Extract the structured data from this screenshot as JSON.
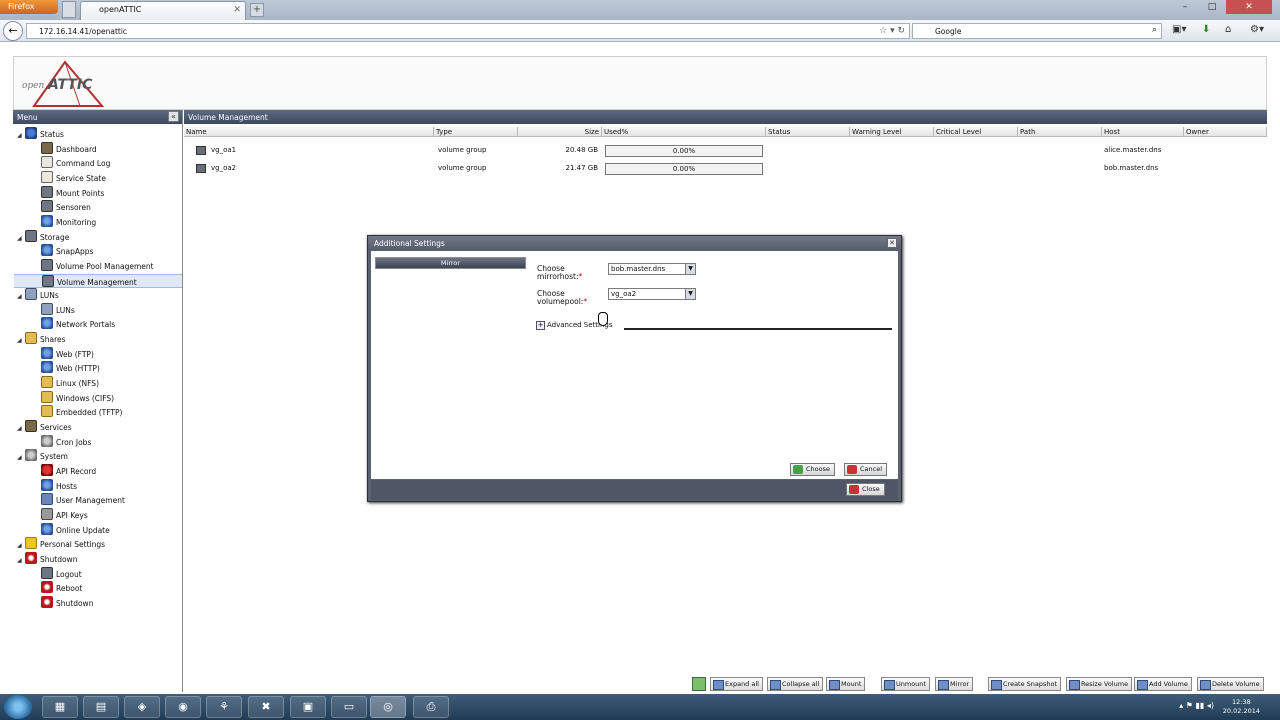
{
  "browser": {
    "app_button": "Firefox",
    "tab_title": "openATTIC",
    "url": "172.16.14.41/openattic",
    "search_engine": "Google",
    "window_controls": [
      "–",
      "□",
      "✕"
    ]
  },
  "app": {
    "logo_text_open": "open",
    "logo_text_attic": "ATTIC"
  },
  "menu": {
    "title": "Menu",
    "items": [
      {
        "label": "Status",
        "icon": "status-icon",
        "level": 0
      },
      {
        "label": "Dashboard",
        "icon": "dashboard-icon",
        "level": 1
      },
      {
        "label": "Command Log",
        "icon": "log-icon",
        "level": 1
      },
      {
        "label": "Service State",
        "icon": "service-icon",
        "level": 1
      },
      {
        "label": "Mount Points",
        "icon": "mount-icon",
        "level": 1
      },
      {
        "label": "Sensoren",
        "icon": "sensor-icon",
        "level": 1
      },
      {
        "label": "Monitoring",
        "icon": "monitoring-icon",
        "level": 1
      },
      {
        "label": "Storage",
        "icon": "storage-icon",
        "level": 0
      },
      {
        "label": "SnapApps",
        "icon": "snapapps-icon",
        "level": 1
      },
      {
        "label": "Volume Pool Management",
        "icon": "pool-icon",
        "level": 1
      },
      {
        "label": "Volume Management",
        "icon": "volume-icon",
        "level": 1,
        "selected": true
      },
      {
        "label": "LUNs",
        "icon": "luns-icon",
        "level": 0
      },
      {
        "label": "LUNs",
        "icon": "lun-icon",
        "level": 1
      },
      {
        "label": "Network Portals",
        "icon": "network-icon",
        "level": 1
      },
      {
        "label": "Shares",
        "icon": "shares-icon",
        "level": 0
      },
      {
        "label": "Web (FTP)",
        "icon": "globe-icon",
        "level": 1
      },
      {
        "label": "Web (HTTP)",
        "icon": "globe-icon",
        "level": 1
      },
      {
        "label": "Linux (NFS)",
        "icon": "folder-icon",
        "level": 1
      },
      {
        "label": "Windows (CIFS)",
        "icon": "folder-icon",
        "level": 1
      },
      {
        "label": "Embedded (TFTP)",
        "icon": "folder-icon",
        "level": 1
      },
      {
        "label": "Services",
        "icon": "services-icon",
        "level": 0
      },
      {
        "label": "Cron Jobs",
        "icon": "cron-icon",
        "level": 1
      },
      {
        "label": "System",
        "icon": "system-icon",
        "level": 0
      },
      {
        "label": "API Record",
        "icon": "record-icon",
        "level": 1
      },
      {
        "label": "Hosts",
        "icon": "hosts-icon",
        "level": 1
      },
      {
        "label": "User Management",
        "icon": "user-icon",
        "level": 1
      },
      {
        "label": "API Keys",
        "icon": "key-icon",
        "level": 1
      },
      {
        "label": "Online Update",
        "icon": "update-icon",
        "level": 1
      },
      {
        "label": "Personal Settings",
        "icon": "star-icon",
        "level": 0
      },
      {
        "label": "Shutdown",
        "icon": "power-icon",
        "level": 0
      },
      {
        "label": "Logout",
        "icon": "logout-icon",
        "level": 1
      },
      {
        "label": "Reboot",
        "icon": "reboot-icon",
        "level": 1
      },
      {
        "label": "Shutdown",
        "icon": "power-icon",
        "level": 1
      }
    ]
  },
  "main": {
    "title": "Volume Management",
    "columns": [
      "Name",
      "Type",
      "Size",
      "Used%",
      "Status",
      "Warning Level",
      "Critical Level",
      "Path",
      "Host",
      "Owner"
    ],
    "rows": [
      {
        "name": "vg_oa1",
        "type": "volume group",
        "size": "20.48 GB",
        "used": "0.00%",
        "host": "alice.master.dns"
      },
      {
        "name": "vg_oa2",
        "type": "volume group",
        "size": "21.47 GB",
        "used": "0.00%",
        "host": "bob.master.dns"
      }
    ],
    "toolbar": [
      "Expand all",
      "Collapse all",
      "Mount",
      "Unmount",
      "Mirror",
      "Create Snapshot",
      "Resize Volume",
      "Add Volume",
      "Delete Volume"
    ]
  },
  "dialog": {
    "title": "Additional Settings",
    "nav_item": "Mirror",
    "mirrorhost_label": "Choose mirrorhost:",
    "mirrorhost_value": "bob.master.dns",
    "volumepool_label": "Choose volumepool:",
    "volumepool_value": "vg_oa2",
    "advanced_label": "Advanced Settings",
    "choose_button": "Choose",
    "cancel_button": "Cancel",
    "close_button": "Close"
  },
  "taskbar": {
    "time": "12:38",
    "date": "20.02.2014"
  }
}
